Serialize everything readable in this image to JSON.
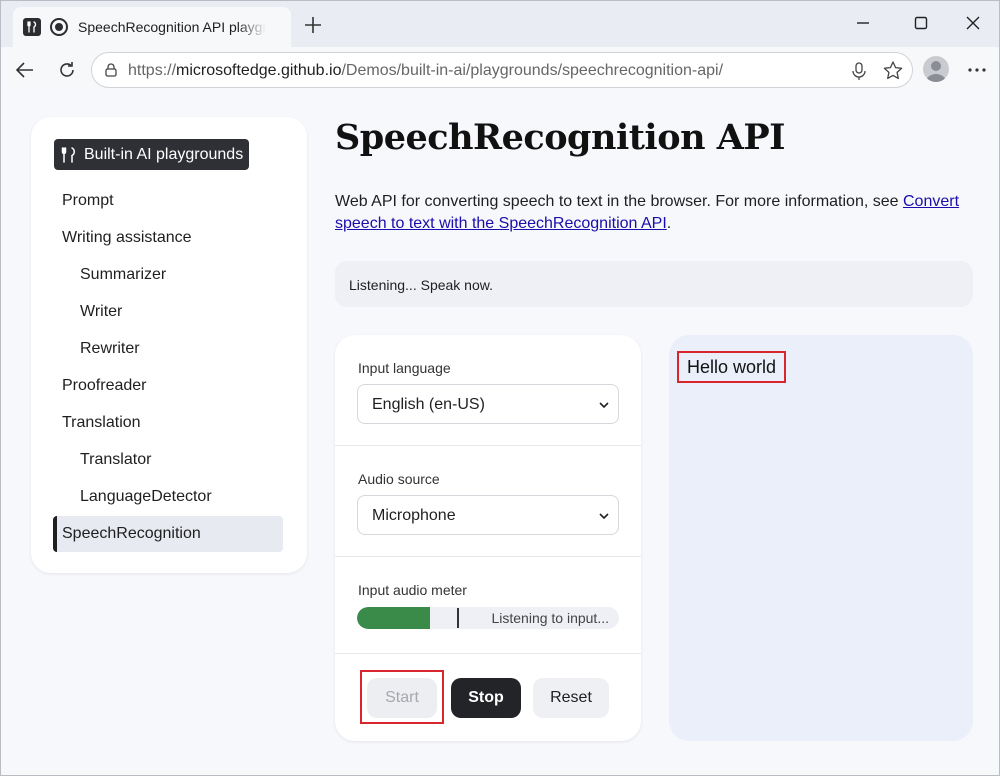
{
  "tab": {
    "title": "SpeechRecognition API playgrounds"
  },
  "address": {
    "scheme": "https://",
    "host": "microsoftedge.github.io",
    "path": "/Demos/built-in-ai/playgrounds/speechrecognition-api/"
  },
  "sidebar": {
    "badge": "Built-in AI playgrounds",
    "items": [
      {
        "label": "Prompt"
      },
      {
        "label": "Writing assistance"
      },
      {
        "label": "Summarizer"
      },
      {
        "label": "Writer"
      },
      {
        "label": "Rewriter"
      },
      {
        "label": "Proofreader"
      },
      {
        "label": "Translation"
      },
      {
        "label": "Translator"
      },
      {
        "label": "LanguageDetector"
      },
      {
        "label": "SpeechRecognition"
      }
    ]
  },
  "main": {
    "title": "SpeechRecognition API",
    "intro": "Web API for converting speech to text in the browser. For more information, see ",
    "intro_link": "Convert speech to text with the SpeechRecognition API",
    "intro_end": ".",
    "status": "Listening... Speak now."
  },
  "controls": {
    "input_language_label": "Input language",
    "input_language_value": "English (en-US)",
    "audio_source_label": "Audio source",
    "audio_source_value": "Microphone",
    "meter_label": "Input audio meter",
    "meter_text": "Listening to input...",
    "meter_level": 0.28,
    "start_label": "Start",
    "stop_label": "Stop",
    "reset_label": "Reset"
  },
  "output": {
    "text": "Hello world"
  },
  "colors": {
    "accent_dark": "#232427",
    "meter_green": "#3a8a4a",
    "highlight_red": "#d9262e",
    "output_bg": "#eaeffa"
  }
}
